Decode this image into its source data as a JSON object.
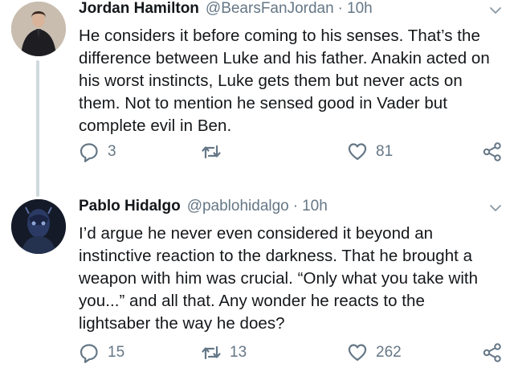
{
  "tweets": [
    {
      "name": "Jordan Hamilton",
      "handle": "@BearsFanJordan",
      "dot": "·",
      "time": "10h",
      "text": "He considers it before coming to his senses. That’s the\ndifference between Luke and his father. Anakin acted on\nhis worst instincts, Luke gets them but never acts on\nthem. Not to mention he sensed good in Vader but\ncomplete evil in Ben.",
      "replies": "3",
      "retweets": "",
      "likes": "81"
    },
    {
      "name": "Pablo Hidalgo",
      "handle": "@pablohidalgo",
      "dot": "·",
      "time": "10h",
      "text": "I’d argue he never even considered it beyond an\ninstinctive reaction to the darkness. That he brought a\nweapon with him was crucial. “Only what you take with\nyou...” and all that. Any wonder he reacts to the\nlightsaber the way he does?",
      "replies": "15",
      "retweets": "13",
      "likes": "262"
    }
  ],
  "icons": {
    "reply": "reply-icon",
    "retweet": "retweet-icon",
    "like": "heart-icon",
    "share": "share-icon",
    "more": "chevron-down-icon"
  },
  "colors": {
    "text": "#14171a",
    "secondary": "#657786",
    "thread_line": "#cfd9de"
  }
}
